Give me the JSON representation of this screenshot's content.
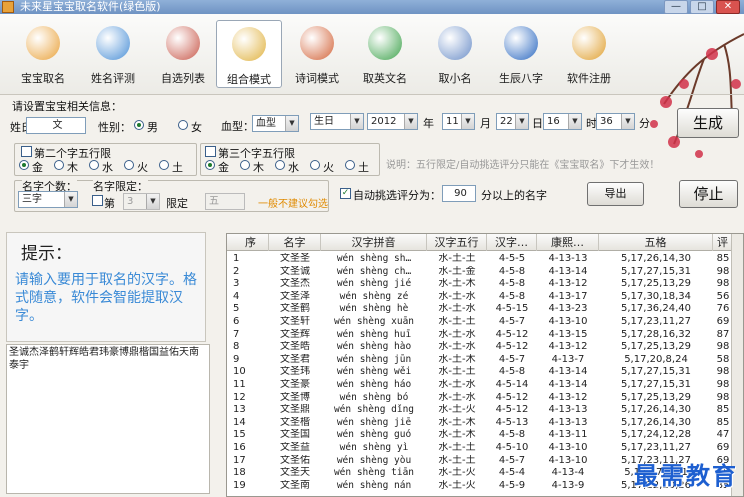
{
  "window": {
    "title": "未来星宝宝取名软件(绿色版)",
    "min": "—",
    "max": "□",
    "close": "✕"
  },
  "toolbar": [
    {
      "label": "宝宝取名",
      "icon": "baby-icon",
      "color": "#e9a23b"
    },
    {
      "label": "姓名评测",
      "icon": "magnifier-icon",
      "color": "#4a8fd6"
    },
    {
      "label": "自选列表",
      "icon": "brushes-icon",
      "color": "#c8594b"
    },
    {
      "label": "组合模式",
      "icon": "bottle-icon",
      "color": "#e0b240"
    },
    {
      "label": "诗词模式",
      "icon": "tiles-icon",
      "color": "#d3643a"
    },
    {
      "label": "取英文名",
      "icon": "triangle-icon",
      "color": "#3fa34d"
    },
    {
      "label": "取小名",
      "icon": "crown-icon",
      "color": "#6c8fc8"
    },
    {
      "label": "生辰八字",
      "icon": "sphere-icon",
      "color": "#2b68c0"
    },
    {
      "label": "软件注册",
      "icon": "lock-icon",
      "color": "#e0a030"
    }
  ],
  "form": {
    "section": "请设置宝宝相关信息：",
    "surname_label": "姓氏：",
    "surname": "文",
    "gender_label": "性别：",
    "male": "男",
    "female": "女",
    "blood_label": "血型：",
    "blood": "血型",
    "calendar": "生日",
    "year": "2012",
    "year_unit": "年",
    "month": "11",
    "month_unit": "月",
    "day": "22",
    "day_unit": "日",
    "hour": "16",
    "hour_unit": "时",
    "minute": "36",
    "minute_unit": "分",
    "generate": "生成",
    "second_wx": "第二个字五行限",
    "third_wx": "第三个字五行限",
    "wx": [
      "金",
      "木",
      "水",
      "火",
      "土"
    ],
    "explain": "说明：五行限定/自动挑选评分只能在《宝宝取名》下才生效！",
    "count_label": "名字个数：",
    "count": "三字",
    "limit_label": "名字限定：",
    "limit_di": "第",
    "limit_pos": "3",
    "limit_fixed": "限定",
    "limit_char": "五",
    "limit_warn": "一般不建议勾选",
    "auto_label": "自动挑选评分为：",
    "auto_score": "90",
    "auto_suffix": "分以上的名字",
    "export": "导出",
    "stop": "停止"
  },
  "tip": {
    "heading": "提示：",
    "text": "请输入要用于取名的汉字。格式随意，软件会智能提取汉字。"
  },
  "chars": "圣诚杰泽鹤轩辉皓君玮豪博鼎楷国益佑天南泰宇",
  "table": {
    "headers": [
      "序",
      "名字",
      "汉字拼音",
      "汉字五行",
      "汉字…",
      "康熙…",
      "五格",
      "评"
    ],
    "rows": [
      [
        "1",
        "文圣圣",
        "wén shèng sh…",
        "水-土-土",
        "4-5-5",
        "4-13-13",
        "5,17,26,14,30",
        "85"
      ],
      [
        "2",
        "文圣诚",
        "wén shèng ch…",
        "水-土-金",
        "4-5-8",
        "4-13-14",
        "5,17,27,15,31",
        "98"
      ],
      [
        "3",
        "文圣杰",
        "wén shèng jié",
        "水-土-木",
        "4-5-8",
        "4-13-12",
        "5,17,25,13,29",
        "98"
      ],
      [
        "4",
        "文圣泽",
        "wén shèng zé",
        "水-土-水",
        "4-5-8",
        "4-13-17",
        "5,17,30,18,34",
        "56"
      ],
      [
        "5",
        "文圣鹤",
        "wén shèng hè",
        "水-土-水",
        "4-5-15",
        "4-13-23",
        "5,17,36,24,40",
        "76"
      ],
      [
        "6",
        "文圣轩",
        "wén shèng xuān",
        "水-土-土",
        "4-5-7",
        "4-13-10",
        "5,17,23,11,27",
        "69"
      ],
      [
        "7",
        "文圣辉",
        "wén shèng huī",
        "水-土-水",
        "4-5-12",
        "4-13-15",
        "5,17,28,16,32",
        "87"
      ],
      [
        "8",
        "文圣皓",
        "wén shèng hào",
        "水-土-水",
        "4-5-12",
        "4-13-12",
        "5,17,25,13,29",
        "98"
      ],
      [
        "9",
        "文圣君",
        "wén shèng jūn",
        "水-土-木",
        "4-5-7",
        "4-13-7",
        "5,17,20,8,24",
        "58"
      ],
      [
        "10",
        "文圣玮",
        "wén shèng wěi",
        "水-土-土",
        "4-5-8",
        "4-13-14",
        "5,17,27,15,31",
        "98"
      ],
      [
        "11",
        "文圣豪",
        "wén shèng háo",
        "水-土-水",
        "4-5-14",
        "4-13-14",
        "5,17,27,15,31",
        "98"
      ],
      [
        "12",
        "文圣博",
        "wén shèng bó",
        "水-土-水",
        "4-5-12",
        "4-13-12",
        "5,17,25,13,29",
        "98"
      ],
      [
        "13",
        "文圣鼎",
        "wén shèng dǐng",
        "水-土-火",
        "4-5-12",
        "4-13-13",
        "5,17,26,14,30",
        "85"
      ],
      [
        "14",
        "文圣楷",
        "wén shèng jiē",
        "水-土-木",
        "4-5-13",
        "4-13-13",
        "5,17,26,14,30",
        "85"
      ],
      [
        "15",
        "文圣国",
        "wén shèng guó",
        "水-土-木",
        "4-5-8",
        "4-13-11",
        "5,17,24,12,28",
        "47"
      ],
      [
        "16",
        "文圣益",
        "wén shèng yì",
        "水-土-土",
        "4-5-10",
        "4-13-10",
        "5,17,23,11,27",
        "69"
      ],
      [
        "17",
        "文圣佑",
        "wén shèng yòu",
        "水-土-土",
        "4-5-7",
        "4-13-10",
        "5,17,23,11,27",
        "69"
      ],
      [
        "18",
        "文圣天",
        "wén shèng tiān",
        "水-土-火",
        "4-5-4",
        "4-13-4",
        "5,17,17,5,21",
        "65"
      ],
      [
        "19",
        "文圣南",
        "wén shèng nán",
        "水-土-火",
        "4-5-9",
        "4-13-9",
        "5,17,22,10,26",
        "85"
      ]
    ]
  },
  "watermark": "最需教育"
}
